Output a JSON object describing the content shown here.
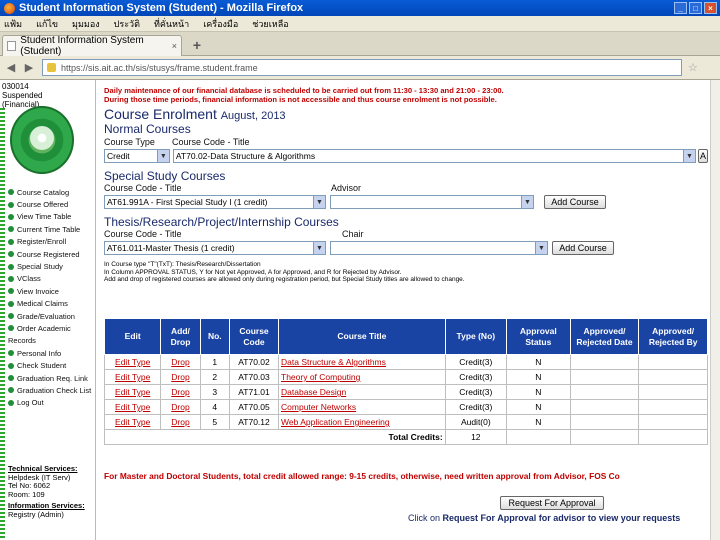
{
  "window": {
    "title": "Student Information System (Student) - Mozilla Firefox"
  },
  "menu": [
    "แฟ้ม",
    "แก้ไข",
    "มุมมอง",
    "ประวัติ",
    "ที่คั่นหน้า",
    "เครื่องมือ",
    "ช่วยเหลือ"
  ],
  "tab": {
    "label": "Student Information System (Student)",
    "close": "×"
  },
  "newtab": "+",
  "url": "https://sis.ait.ac.th/sis/stusys/frame.student.frame",
  "user": {
    "id": "030014",
    "status": "Suspended",
    "note": "(Financial)"
  },
  "nav": [
    "Course Catalog",
    "Course Offered",
    "View Time Table",
    "Current Time Table",
    "Register/Enroll",
    "Course Registered",
    "Special Study",
    "VClass",
    "View Invoice",
    "Medical Claims",
    "Grade/Evaluation",
    "Order Academic",
    "Records",
    "Personal Info",
    "Check Student",
    "Graduation Req. Link",
    "Graduation Check List",
    "Log Out"
  ],
  "services": {
    "tech_header": "Technical Services:",
    "tech_lines": [
      "Helpdesk (IT Serv)",
      "Tel No: 6062",
      "Room: 109"
    ],
    "info_header": "Information Services:",
    "info_lines": [
      "Registry (Admin)"
    ]
  },
  "notice": {
    "line1": "Daily maintenance of our financial database is scheduled to be carried out from 11:30 - 13:30 and 21:00 - 23:00.",
    "line2": "During those time periods, financial information is not accessible and thus course enrolment is not possible."
  },
  "heading": {
    "title": "Course Enrolment",
    "date": "August, 2013"
  },
  "normal": {
    "heading": "Normal Courses",
    "type_label": "Course Type",
    "code_label": "Course Code - Title",
    "type_value": "Credit",
    "code_value": "AT70.02-Data Structure & Algorithms"
  },
  "special": {
    "heading": "Special Study Courses",
    "code_label": "Course Code - Title",
    "advisor_label": "Advisor",
    "code_value": "AT61.991A - First Special Study I (1 credit)",
    "advisor_value": "",
    "button": "Add Course"
  },
  "thesis": {
    "heading": "Thesis/Research/Project/Internship Courses",
    "code_label": "Course Code - Title",
    "chair_label": "Chair",
    "code_value": "AT61.011-Master Thesis (1 credit)",
    "chair_value": "",
    "button": "Add Course"
  },
  "small_notes": [
    "In Course type \"T\"(TxT): Thesis/Research/Dissertation",
    "In Column APPROVAL STATUS, Y for Not yet Approved, A for Approved, and R for Rejected by Advisor.",
    "Add and drop of registered courses are allowed only during registration period, but Special Study titles are allowed to change."
  ],
  "table": {
    "headers": [
      "Edit",
      "Add/ Drop",
      "No.",
      "Course Code",
      "Course Title",
      "Type (No)",
      "Approval Status",
      "Approved/ Rejected Date",
      "Approved/ Rejected By"
    ],
    "rows": [
      {
        "edit": "Edit Type",
        "drop": "Drop",
        "no": "1",
        "code": "AT70.02",
        "title": "Data Structure & Algorithms",
        "type": "Credit(3)",
        "status": "N",
        "date": "",
        "by": ""
      },
      {
        "edit": "Edit Type",
        "drop": "Drop",
        "no": "2",
        "code": "AT70.03",
        "title": "Theory of Computing",
        "type": "Credit(3)",
        "status": "N",
        "date": "",
        "by": ""
      },
      {
        "edit": "Edit Type",
        "drop": "Drop",
        "no": "3",
        "code": "AT71.01",
        "title": "Database Design",
        "type": "Credit(3)",
        "status": "N",
        "date": "",
        "by": ""
      },
      {
        "edit": "Edit Type",
        "drop": "Drop",
        "no": "4",
        "code": "AT70.05",
        "title": "Computer Networks",
        "type": "Credit(3)",
        "status": "N",
        "date": "",
        "by": ""
      },
      {
        "edit": "Edit Type",
        "drop": "Drop",
        "no": "5",
        "code": "AT70.12",
        "title": "Web Application Engineering",
        "type": "Audit(0)",
        "status": "N",
        "date": "",
        "by": ""
      }
    ],
    "total_label": "Total Credits:",
    "total_value": "12"
  },
  "warning": "For Master and Doctoral Students, total credit allowed range: 9-15 credits, otherwise, need written approval from Advisor, FOS Co",
  "request_button": "Request For Approval",
  "click_note": {
    "pre": "Click on",
    "link": "Request For Approval",
    "post": "for advisor to view your requests"
  }
}
